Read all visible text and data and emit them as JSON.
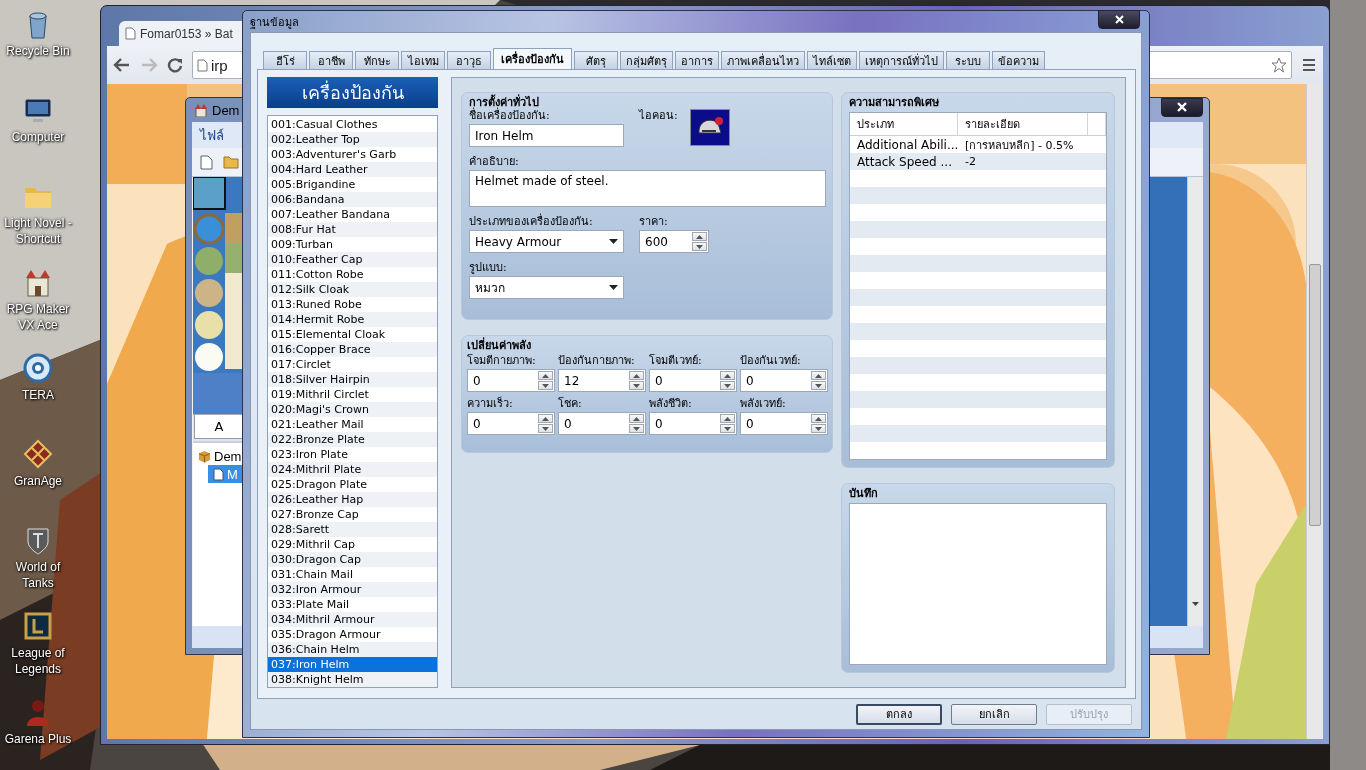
{
  "desktop": {
    "icons": [
      {
        "label": "Recycle Bin"
      },
      {
        "label": "Computer"
      },
      {
        "label": "Light Novel - Shortcut"
      },
      {
        "label": "RPG Maker VX Ace"
      },
      {
        "label": "TERA"
      },
      {
        "label": "GranAge"
      },
      {
        "label": "World of Tanks"
      },
      {
        "label": "League of Legends"
      },
      {
        "label": "Garena Plus"
      }
    ]
  },
  "browser": {
    "tab_title": "Fomar0153 » Bat",
    "address": "irp"
  },
  "editor": {
    "title": "Dem",
    "menu": [
      "ไฟล์"
    ],
    "tile_tab": "A",
    "tree": [
      {
        "label": "Dem",
        "selected": false,
        "children": [
          {
            "label": "M",
            "selected": true
          }
        ]
      }
    ]
  },
  "dialog": {
    "title": "ฐานข้อมูล",
    "tabs": [
      {
        "label": "ฮีโร่",
        "selected": false
      },
      {
        "label": "อาชีพ",
        "selected": false
      },
      {
        "label": "ทักษะ",
        "selected": false
      },
      {
        "label": "ไอเทม",
        "selected": false
      },
      {
        "label": "อาวุธ",
        "selected": false
      },
      {
        "label": "เครื่องป้องกัน",
        "selected": true
      },
      {
        "label": "ศัตรุ",
        "selected": false
      },
      {
        "label": "กลุ่มศัตรุ",
        "selected": false
      },
      {
        "label": "อาการ",
        "selected": false
      },
      {
        "label": "ภาพเคลื่อนไหว",
        "selected": false
      },
      {
        "label": "ไทล์เซต",
        "selected": false
      },
      {
        "label": "เหตุการณ์ทั่วไป",
        "selected": false
      },
      {
        "label": "ระบบ",
        "selected": false
      },
      {
        "label": "ข้อความ",
        "selected": false
      }
    ],
    "list": {
      "header": "เครื่องป้องกัน",
      "items": [
        {
          "label": "001:Casual Clothes",
          "selected": false
        },
        {
          "label": "002:Leather Top",
          "selected": false
        },
        {
          "label": "003:Adventurer's Garb",
          "selected": false
        },
        {
          "label": "004:Hard Leather",
          "selected": false
        },
        {
          "label": "005:Brigandine",
          "selected": false
        },
        {
          "label": "006:Bandana",
          "selected": false
        },
        {
          "label": "007:Leather Bandana",
          "selected": false
        },
        {
          "label": "008:Fur Hat",
          "selected": false
        },
        {
          "label": "009:Turban",
          "selected": false
        },
        {
          "label": "010:Feather Cap",
          "selected": false
        },
        {
          "label": "011:Cotton Robe",
          "selected": false
        },
        {
          "label": "012:Silk Cloak",
          "selected": false
        },
        {
          "label": "013:Runed Robe",
          "selected": false
        },
        {
          "label": "014:Hermit Robe",
          "selected": false
        },
        {
          "label": "015:Elemental Cloak",
          "selected": false
        },
        {
          "label": "016:Copper Brace",
          "selected": false
        },
        {
          "label": "017:Circlet",
          "selected": false
        },
        {
          "label": "018:Silver Hairpin",
          "selected": false
        },
        {
          "label": "019:Mithril Circlet",
          "selected": false
        },
        {
          "label": "020:Magi's Crown",
          "selected": false
        },
        {
          "label": "021:Leather Mail",
          "selected": false
        },
        {
          "label": "022:Bronze Plate",
          "selected": false
        },
        {
          "label": "023:Iron Plate",
          "selected": false
        },
        {
          "label": "024:Mithril Plate",
          "selected": false
        },
        {
          "label": "025:Dragon Plate",
          "selected": false
        },
        {
          "label": "026:Leather Hap",
          "selected": false
        },
        {
          "label": "027:Bronze Cap",
          "selected": false
        },
        {
          "label": "028:Sarett",
          "selected": false
        },
        {
          "label": "029:Mithril Cap",
          "selected": false
        },
        {
          "label": "030:Dragon Cap",
          "selected": false
        },
        {
          "label": "031:Chain Mail",
          "selected": false
        },
        {
          "label": "032:Iron Armour",
          "selected": false
        },
        {
          "label": "033:Plate Mail",
          "selected": false
        },
        {
          "label": "034:Mithril Armour",
          "selected": false
        },
        {
          "label": "035:Dragon Armour",
          "selected": false
        },
        {
          "label": "036:Chain Helm",
          "selected": false
        },
        {
          "label": "037:Iron Helm",
          "selected": true
        },
        {
          "label": "038:Knight Helm",
          "selected": false
        }
      ]
    },
    "general": {
      "title": "การตั้งค่าทั่วไป",
      "name_label": "ชื่อเครื่องป้องกัน:",
      "name": "Iron Helm",
      "icon_label": "ไอคอน:",
      "description_label": "คำอธิบาย:",
      "description": "Helmet made of steel.",
      "type_label": "ประเภทของเครื่องป้องกัน:",
      "type": "Heavy Armour",
      "price_label": "ราคา:",
      "price": "600",
      "slot_label": "รูปแบบ:",
      "slot": "หมวก"
    },
    "params": {
      "title": "เปลี่ยนค่าพลัง",
      "fields": [
        {
          "label": "โจมตีกายภาพ:",
          "value": "0"
        },
        {
          "label": "ป้องกันกายภาพ:",
          "value": "12"
        },
        {
          "label": "โจมตีเวทย์:",
          "value": "0"
        },
        {
          "label": "ป้องกันเวทย์:",
          "value": "0"
        },
        {
          "label": "ความเร็ว:",
          "value": "0"
        },
        {
          "label": "โชค:",
          "value": "0"
        },
        {
          "label": "พลังชีวิต:",
          "value": "0"
        },
        {
          "label": "พลังเวทย์:",
          "value": "0"
        }
      ]
    },
    "features": {
      "title": "ความสามารถพิเศษ",
      "columns": [
        "ประเภท",
        "รายละเอียด"
      ],
      "rows": [
        [
          "Additional Abili...",
          "[การหลบหลีก] - 0.5%"
        ],
        [
          "Attack Speed ...",
          "-2"
        ]
      ]
    },
    "note": {
      "title": "บันทึก"
    },
    "buttons": [
      {
        "label": "ตกลง",
        "disabled": false
      },
      {
        "label": "ยกเลิก",
        "disabled": false
      },
      {
        "label": "ปรับปรุง",
        "disabled": true
      }
    ]
  }
}
